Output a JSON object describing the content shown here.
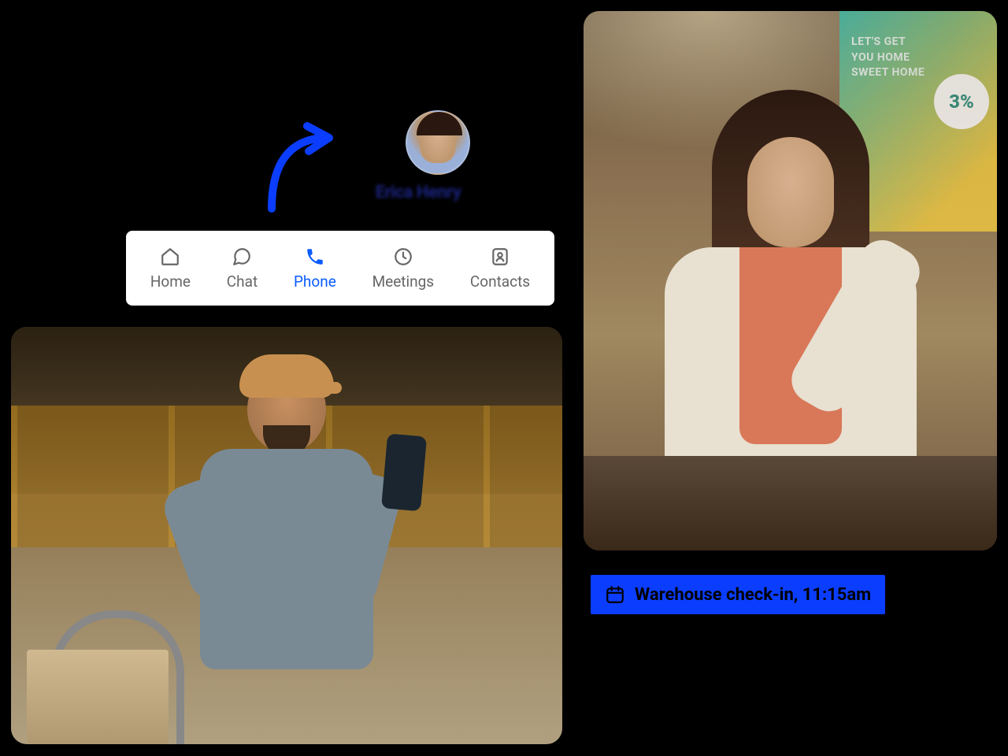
{
  "contact": {
    "name": "Erica Henry"
  },
  "nav": {
    "items": [
      {
        "label": "Home",
        "icon": "home-icon",
        "active": false
      },
      {
        "label": "Chat",
        "icon": "chat-icon",
        "active": false
      },
      {
        "label": "Phone",
        "icon": "phone-icon",
        "active": true
      },
      {
        "label": "Meetings",
        "icon": "clock-icon",
        "active": false
      },
      {
        "label": "Contacts",
        "icon": "contacts-icon",
        "active": false
      }
    ]
  },
  "event": {
    "label": "Warehouse check-in, 11:15am"
  },
  "poster": {
    "line1": "LET'S GET",
    "line2": "YOU HOME",
    "line3": "SWEET HOME",
    "badge": "3%"
  },
  "colors": {
    "accent": "#0b5cff",
    "chip_bg": "#0b3dff",
    "name_text": "#1a237e"
  }
}
